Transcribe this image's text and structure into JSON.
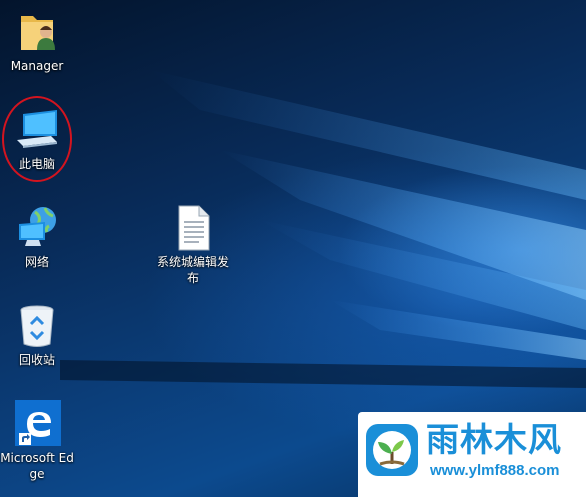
{
  "desktop": {
    "icons": [
      {
        "name": "Manager",
        "icon": "user-folder-icon"
      },
      {
        "name": "此电脑",
        "icon": "this-pc-icon",
        "highlighted": true
      },
      {
        "name": "网络",
        "icon": "network-icon"
      },
      {
        "name": "系统城编辑发布",
        "icon": "text-file-icon"
      },
      {
        "name": "回收站",
        "icon": "recycle-bin-icon"
      },
      {
        "name": "Microsoft Edge",
        "icon": "edge-icon",
        "shortcut": true
      }
    ],
    "highlight_color": "#d3141f"
  },
  "watermark": {
    "brand": "雨林木风",
    "url": "www.ylmf888.com",
    "color": "#1a8fd8"
  }
}
